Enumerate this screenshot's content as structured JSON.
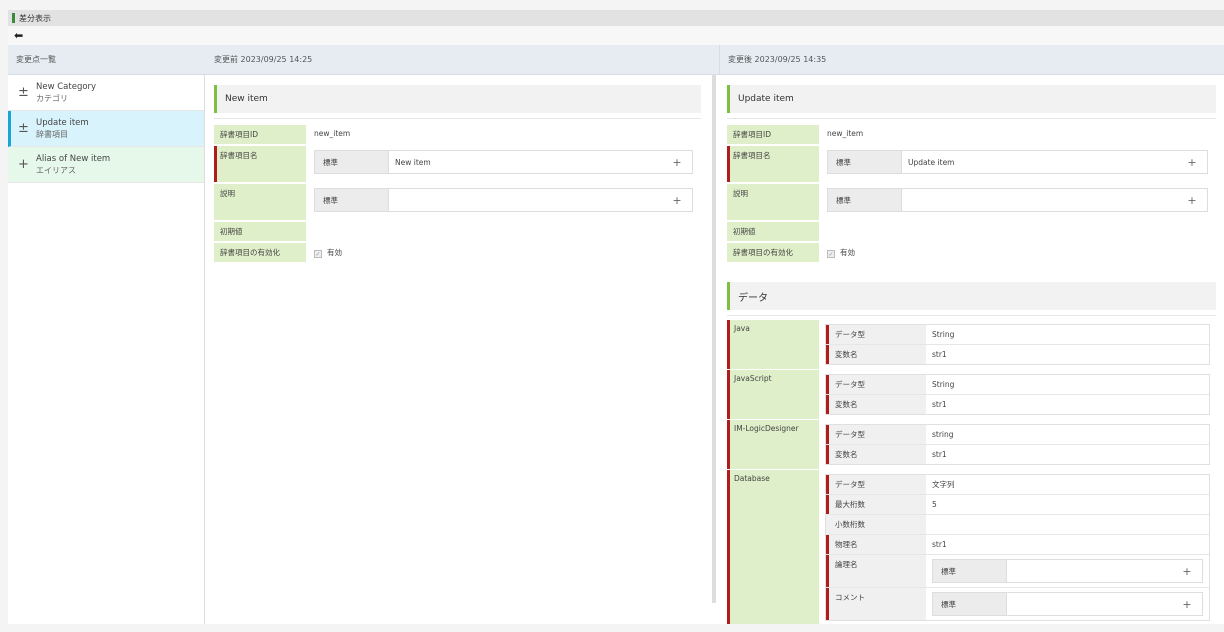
{
  "window": {
    "title": "差分表示"
  },
  "nav": {
    "back_icon": "arrow-left-icon"
  },
  "sidebar": {
    "header": "変更点一覧",
    "items": [
      {
        "symbol": "±",
        "title": "New Category",
        "sub": "カテゴリ"
      },
      {
        "symbol": "±",
        "title": "Update item",
        "sub": "辞書項目"
      },
      {
        "symbol": "+",
        "title": "Alias of New item",
        "sub": "エイリアス"
      }
    ]
  },
  "before": {
    "header": "変更前 2023/09/25 14:25",
    "section_title": "New item",
    "fields": {
      "id_label": "辞書項目ID",
      "id_value": "new_item",
      "name_label": "辞書項目名",
      "name_lang": "標準",
      "name_value": "New item",
      "desc_label": "説明",
      "desc_lang": "標準",
      "desc_value": "",
      "init_label": "初期値",
      "enabled_label": "辞書項目の有効化",
      "enabled_text": "有効"
    }
  },
  "after": {
    "header": "変更後 2023/09/25 14:35",
    "section_title": "Update item",
    "fields": {
      "id_label": "辞書項目ID",
      "id_value": "new_item",
      "name_label": "辞書項目名",
      "name_lang": "標準",
      "name_value": "Update item",
      "desc_label": "説明",
      "desc_lang": "標準",
      "desc_value": "",
      "init_label": "初期値",
      "enabled_label": "辞書項目の有効化",
      "enabled_text": "有効"
    },
    "data_section_title": "データ",
    "data": {
      "java": {
        "label": "Java",
        "type_label": "データ型",
        "type_value": "String",
        "var_label": "変数名",
        "var_value": "str1"
      },
      "js": {
        "label": "JavaScript",
        "type_label": "データ型",
        "type_value": "String",
        "var_label": "変数名",
        "var_value": "str1"
      },
      "logic": {
        "label": "IM-LogicDesigner",
        "type_label": "データ型",
        "type_value": "string",
        "var_label": "変数名",
        "var_value": "str1"
      },
      "db": {
        "label": "Database",
        "type_label": "データ型",
        "type_value": "文字列",
        "maxdigits_label": "最大桁数",
        "maxdigits_value": "5",
        "decimal_label": "小数桁数",
        "decimal_value": "",
        "physical_label": "物理名",
        "physical_value": "str1",
        "logical_label": "論理名",
        "logical_lang": "標準",
        "logical_value": "",
        "comment_label": "コメント",
        "comment_lang": "標準",
        "comment_value": ""
      }
    }
  },
  "icons": {
    "plus": "+",
    "check": "✓"
  }
}
